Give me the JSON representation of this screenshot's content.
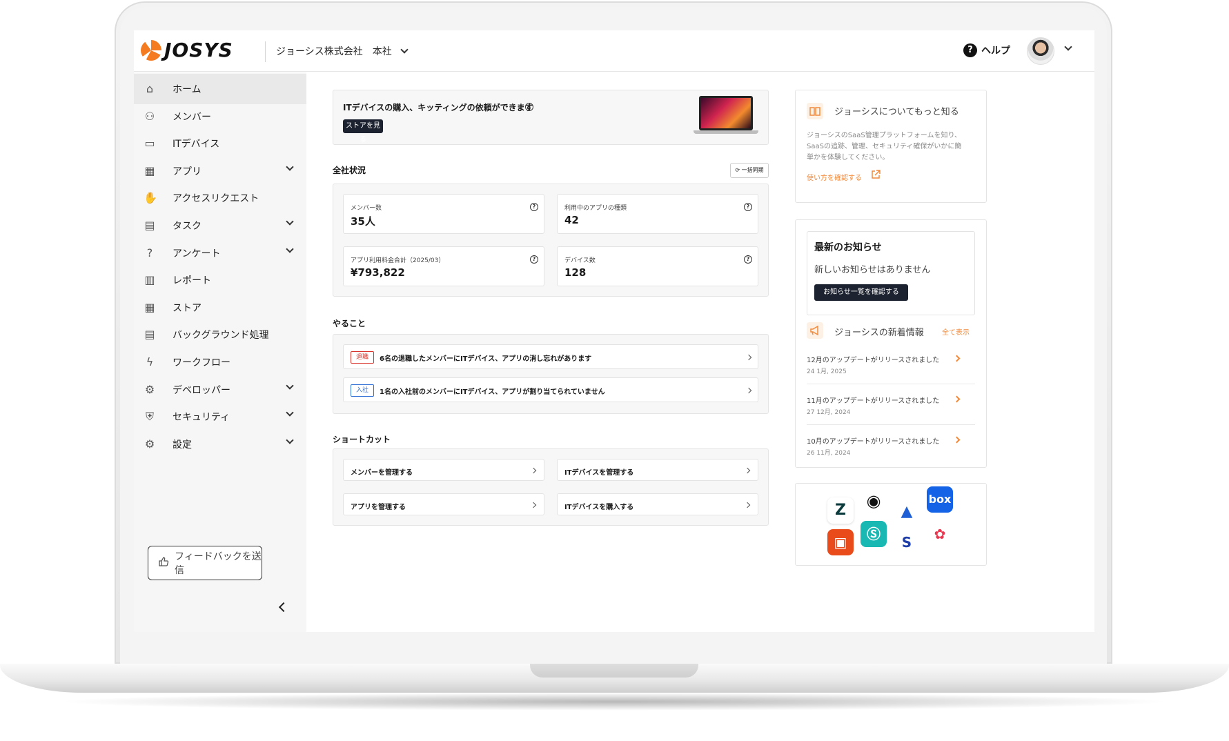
{
  "header": {
    "logo_text": "JOSYS",
    "company": "ジョーシス株式会社",
    "branch": "本社",
    "help_label": "ヘルプ"
  },
  "sidebar": {
    "items": [
      {
        "label": "ホーム",
        "icon": "home-icon",
        "expandable": false,
        "active": true
      },
      {
        "label": "メンバー",
        "icon": "users-icon",
        "expandable": false
      },
      {
        "label": "ITデバイス",
        "icon": "laptop-icon",
        "expandable": false
      },
      {
        "label": "アプリ",
        "icon": "grid-icon",
        "expandable": true
      },
      {
        "label": "アクセスリクエスト",
        "icon": "hand-icon",
        "expandable": false
      },
      {
        "label": "タスク",
        "icon": "calendar-icon",
        "expandable": true
      },
      {
        "label": "アンケート",
        "icon": "question-icon",
        "expandable": true
      },
      {
        "label": "レポート",
        "icon": "report-icon",
        "expandable": false
      },
      {
        "label": "ストア",
        "icon": "store-icon",
        "expandable": false
      },
      {
        "label": "バックグラウンド処理",
        "icon": "calendar-icon",
        "expandable": false
      },
      {
        "label": "ワークフロー",
        "icon": "bolt-icon",
        "expandable": false
      },
      {
        "label": "デベロッパー",
        "icon": "developer-icon",
        "expandable": true
      },
      {
        "label": "セキュリティ",
        "icon": "shield-icon",
        "expandable": true
      },
      {
        "label": "設定",
        "icon": "gear-icon",
        "expandable": true
      }
    ],
    "feedback_label": "フィードバックを送信"
  },
  "banner": {
    "text": "ITデバイスの購入、キッティングの依頼ができます",
    "button": "ストアを見る"
  },
  "overview": {
    "title": "全社状況",
    "sync_label": "一括同期",
    "stats": [
      {
        "label": "メンバー数",
        "value": "35人"
      },
      {
        "label": "利用中のアプリの種類",
        "value": "42"
      },
      {
        "label": "アプリ利用料金合計（2025/03）",
        "value": "¥793,822"
      },
      {
        "label": "デバイス数",
        "value": "128"
      }
    ]
  },
  "todo": {
    "title": "やること",
    "items": [
      {
        "tag": "退職",
        "text": "6名の退職したメンバーにITデバイス、アプリの消し忘れがあります"
      },
      {
        "tag": "入社",
        "text": "1名の入社前のメンバーにITデバイス、アプリが割り当てられていません"
      }
    ]
  },
  "shortcuts": {
    "title": "ショートカット",
    "items": [
      "メンバーを管理する",
      "ITデバイスを管理する",
      "アプリを管理する",
      "ITデバイスを購入する"
    ]
  },
  "about": {
    "title": "ジョーシスについてもっと知る",
    "body_1": "ジョーシスのSaaS管理プラットフォームを知り、",
    "body_2": "SaaSの追跡、管理、セキュリティ確保がいかに簡",
    "body_3": "単かを体験してください。",
    "link": "使い方を確認する"
  },
  "notices": {
    "title": "最新のお知らせ",
    "empty": "新しいお知らせはありません",
    "button": "お知らせ一覧を確認する"
  },
  "news": {
    "title": "ジョーシスの新着情報",
    "view_all": "全て表示",
    "items": [
      {
        "title": "12月のアップデートがリリースされました",
        "date": "24 1月, 2025"
      },
      {
        "title": "11月のアップデートがリリースされました",
        "date": "27 12月, 2024"
      },
      {
        "title": "10月のアップデートがリリースされました",
        "date": "26 11月, 2024"
      }
    ]
  },
  "apps": {
    "logos": [
      "zendesk-icon",
      "github-icon",
      "atlassian-icon",
      "box-icon",
      "office-icon",
      "sansan-icon",
      "smarthr-icon",
      "asana-icon"
    ],
    "box_label": "box",
    "smarthr_label": "S"
  },
  "colors": {
    "accent": "#f08a3c",
    "dark_button": "#1c2230",
    "tag_retire": "#d9342b",
    "tag_join": "#2f6fd6"
  }
}
